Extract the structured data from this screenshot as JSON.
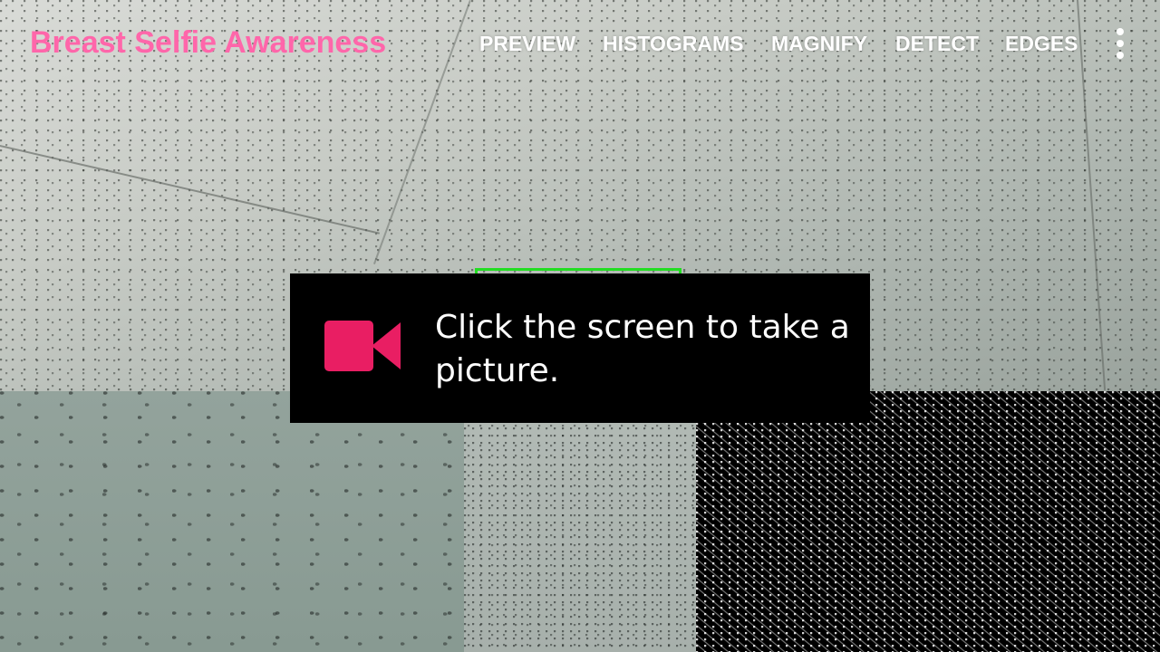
{
  "app": {
    "title": "Breast Selfie Awareness",
    "title_color": "#ff66aa"
  },
  "action_bar": {
    "menu_items": [
      {
        "label": "PREVIEW"
      },
      {
        "label": "HISTOGRAMS"
      },
      {
        "label": "MAGNIFY"
      },
      {
        "label": "DETECT"
      },
      {
        "label": "EDGES"
      }
    ],
    "overflow_icon": "more-vertical-icon"
  },
  "toast": {
    "message": "Click the screen to take a picture.",
    "icon": "video-camera-icon",
    "icon_color": "#e91e63"
  },
  "colors": {
    "detect_box": "#22dd22",
    "toast_background": "#000000"
  }
}
